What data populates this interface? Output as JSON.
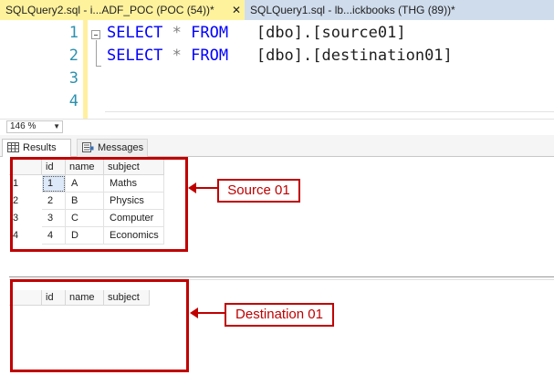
{
  "tabs": [
    {
      "label": "SQLQuery2.sql - i...ADF_POC (POC (54))*",
      "active": true
    },
    {
      "label": "SQLQuery1.sql - lb...ickbooks (THG (89))*",
      "active": false
    }
  ],
  "tab_close_glyph": "✕",
  "editor": {
    "line_numbers": [
      "1",
      "2",
      "3",
      "4"
    ],
    "lines": [
      {
        "kw1": "SELECT",
        "star": "*",
        "kw2": "FROM",
        "object": "[dbo].[source01]"
      },
      {
        "kw1": "SELECT",
        "star": "*",
        "kw2": "FROM",
        "object": "[dbo].[destination01]"
      }
    ]
  },
  "zoom": {
    "value": "146 %"
  },
  "result_tabs": {
    "results_label": "Results",
    "messages_label": "Messages"
  },
  "grid1": {
    "columns": [
      "id",
      "name",
      "subject"
    ],
    "rows": [
      {
        "row": "1",
        "id": "1",
        "name": "A",
        "subject": "Maths"
      },
      {
        "row": "2",
        "id": "2",
        "name": "B",
        "subject": "Physics"
      },
      {
        "row": "3",
        "id": "3",
        "name": "C",
        "subject": "Computer"
      },
      {
        "row": "4",
        "id": "4",
        "name": "D",
        "subject": "Economics"
      }
    ]
  },
  "grid2": {
    "columns": [
      "id",
      "name",
      "subject"
    ],
    "rows": []
  },
  "annotations": {
    "source_label": "Source 01",
    "destination_label": "Destination 01",
    "color": "#c00000"
  },
  "colors": {
    "active_tab": "#fff29d",
    "inactive_tab": "#cfdcec",
    "keyword": "#0000ff",
    "line_number": "#2b91af"
  }
}
